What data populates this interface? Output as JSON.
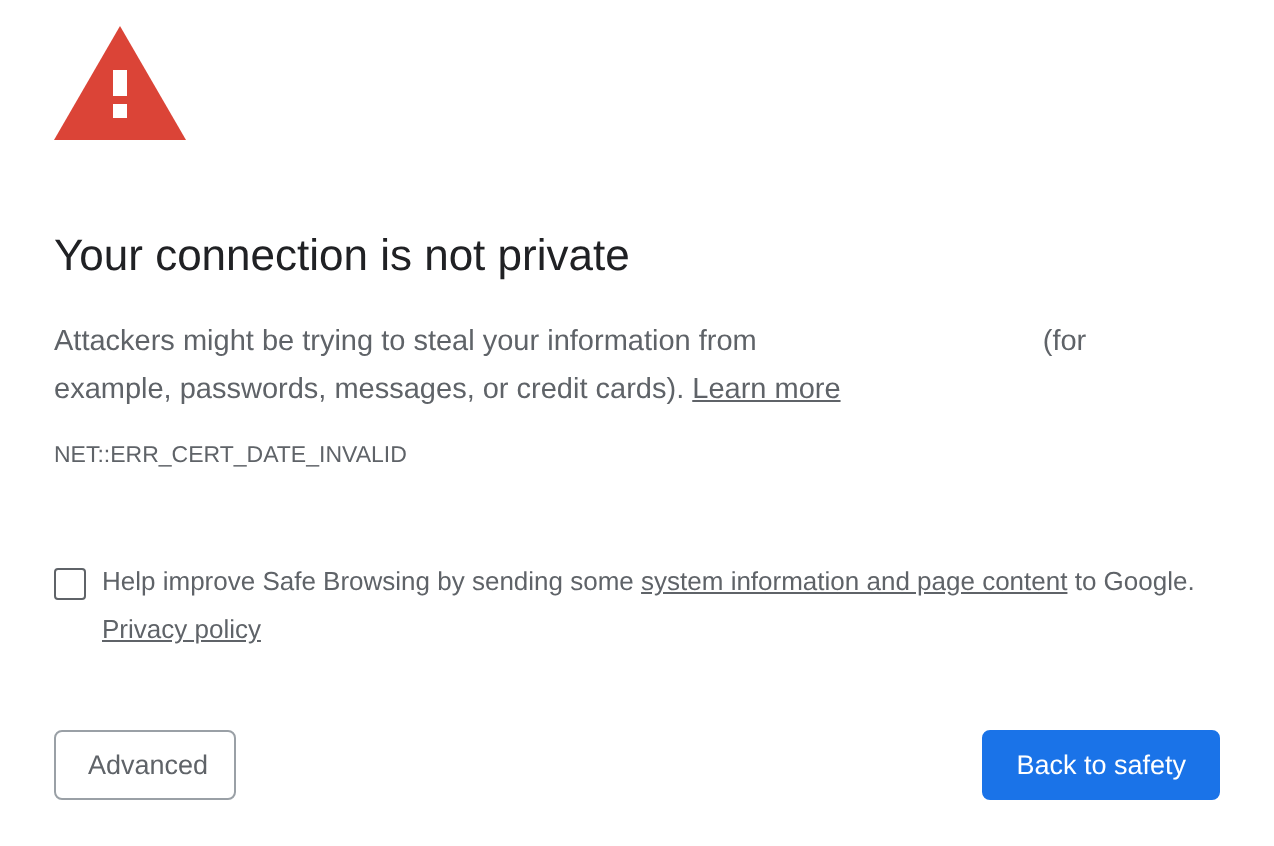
{
  "heading": "Your connection is not private",
  "description": {
    "before": "Attackers might be trying to steal your information from",
    "after": "(for example, passwords, messages, or credit cards).",
    "link": "Learn more"
  },
  "error_code": "NET::ERR_CERT_DATE_INVALID",
  "safe_browsing": {
    "checked": false,
    "before": "Help improve Safe Browsing by sending some",
    "link": "system information and page content",
    "after": "to Google.",
    "policy_link": "Privacy policy"
  },
  "buttons": [
    {
      "label": "Advanced",
      "kind": "secondary"
    },
    {
      "label": "Back to safety",
      "kind": "primary"
    }
  ]
}
